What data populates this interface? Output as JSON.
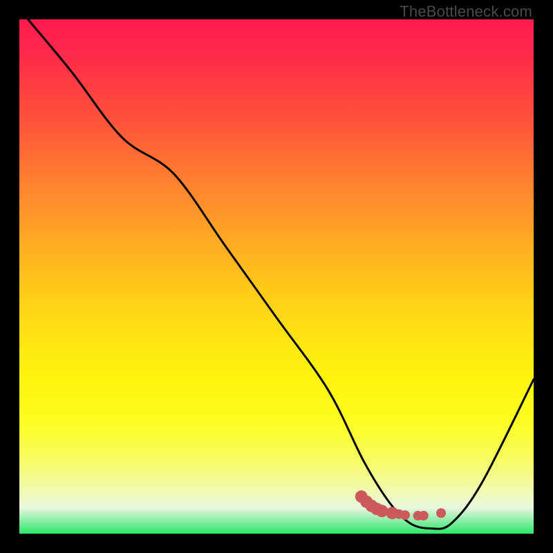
{
  "watermark": "TheBottleneck.com",
  "chart_data": {
    "type": "line",
    "title": "",
    "xlabel": "",
    "ylabel": "",
    "xlim": [
      0,
      100
    ],
    "ylim": [
      0,
      100
    ],
    "grid": false,
    "legend": false,
    "colors": {
      "curve": "#000000",
      "highlight": "#cc5a5a",
      "gradient_top": "#ff1a4d",
      "gradient_bottom": "#2ee66a"
    },
    "series": [
      {
        "name": "main-curve",
        "x": [
          0,
          10,
          20,
          30,
          40,
          50,
          60,
          67,
          72,
          76,
          80,
          84,
          90,
          100
        ],
        "y": [
          102,
          90,
          77,
          70,
          56,
          42,
          28,
          14,
          6,
          2,
          1,
          2,
          10,
          30
        ]
      }
    ],
    "highlight_points": {
      "name": "valley-dots",
      "x": [
        66.5,
        67.5,
        68.5,
        69.5,
        70.5,
        72.5,
        73.8,
        75.0,
        77.5,
        78.6,
        82.0
      ],
      "y": [
        7.2,
        6.2,
        5.4,
        4.8,
        4.4,
        4.0,
        3.8,
        3.6,
        3.5,
        3.5,
        4.0
      ]
    }
  }
}
